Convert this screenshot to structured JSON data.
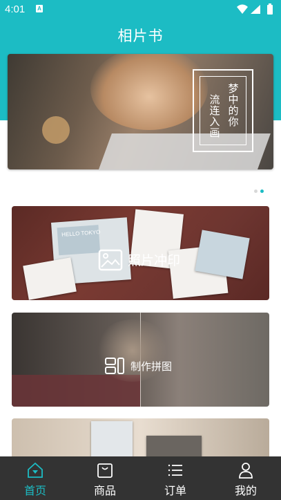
{
  "status_bar": {
    "time": "4:01",
    "notification_glyph": "A"
  },
  "app_bar": {
    "title": "相片书"
  },
  "banner": {
    "poem_col1": [
      "梦",
      "中",
      "的",
      "你"
    ],
    "poem_col2": [
      "流",
      "连",
      "入",
      "画"
    ],
    "page_count": 2,
    "active_page": 2
  },
  "cards": [
    {
      "label": "照片冲印",
      "icon": "image-icon",
      "photo_text": "HELLO TOKYO"
    },
    {
      "label": "制作拼图",
      "icon": "collage-icon"
    },
    {
      "label": "",
      "icon": ""
    }
  ],
  "bottom_nav": [
    {
      "label": "首页",
      "icon": "home-icon",
      "active": true
    },
    {
      "label": "商品",
      "icon": "bag-icon",
      "active": false
    },
    {
      "label": "订单",
      "icon": "list-icon",
      "active": false
    },
    {
      "label": "我的",
      "icon": "person-icon",
      "active": false
    }
  ],
  "colors": {
    "accent": "#1cbcc4",
    "nav_bg": "#333333"
  }
}
